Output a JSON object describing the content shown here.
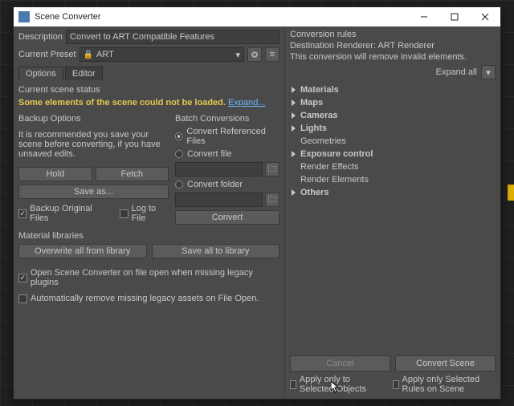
{
  "window": {
    "title": "Scene Converter"
  },
  "desc": {
    "label": "Description",
    "value": "Convert to ART Compatible Features"
  },
  "preset": {
    "label": "Current Preset",
    "value": "ART"
  },
  "tabs": {
    "options": "Options",
    "editor": "Editor"
  },
  "status": {
    "label": "Current scene status",
    "msg": "Some elements of the scene could not be loaded.",
    "link": "Expand..."
  },
  "backup": {
    "title": "Backup Options",
    "note": "It is recommended you save your scene before converting, if you have unsaved edits.",
    "hold": "Hold",
    "fetch": "Fetch",
    "saveas": "Save as...",
    "backup_files": "Backup Original Files",
    "log": "Log to File"
  },
  "batch": {
    "title": "Batch Conversions",
    "ref": "Convert Referenced Files",
    "file": "Convert file",
    "folder": "Convert folder",
    "convert": "Convert"
  },
  "matlib": {
    "title": "Material libraries",
    "overwrite": "Overwrite all from library",
    "saveall": "Save all to library"
  },
  "open_checks": {
    "open_missing": "Open Scene Converter on file open when missing legacy plugins",
    "auto_remove": "Automatically remove missing legacy assets on File Open."
  },
  "rules": {
    "title": "Conversion rules",
    "dest": "Destination Renderer: ART Renderer",
    "note": "This conversion will remove invalid elements.",
    "expand": "Expand all",
    "items": [
      "Materials",
      "Maps",
      "Cameras",
      "Lights",
      "Geometries",
      "Exposure control",
      "Render Effects",
      "Render Elements",
      "Others"
    ]
  },
  "footer": {
    "cancel": "Cancel",
    "convert": "Convert Scene",
    "apply_sel": "Apply only to Selected Objects",
    "apply_rules": "Apply only Selected Rules on Scene"
  }
}
